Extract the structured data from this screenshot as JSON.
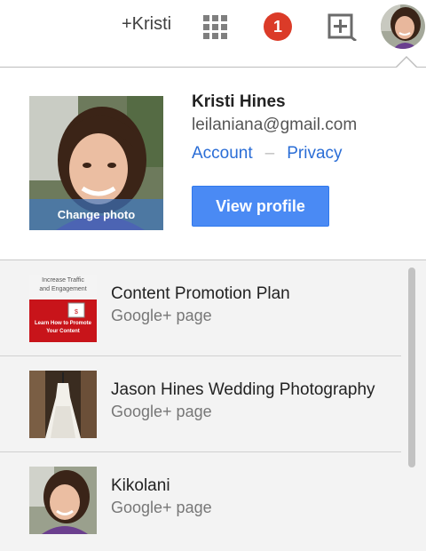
{
  "topbar": {
    "plus_name": "+Kristi",
    "notification_count": "1"
  },
  "user": {
    "name": "Kristi Hines",
    "email": "leilaniana@gmail.com",
    "account_link": "Account",
    "privacy_link": "Privacy",
    "separator": "–",
    "change_photo_label": "Change photo",
    "view_profile_label": "View profile"
  },
  "pages": [
    {
      "name": "Content Promotion Plan",
      "type": "Google+ page"
    },
    {
      "name": "Jason Hines Wedding Photography",
      "type": "Google+ page"
    },
    {
      "name": "Kikolani",
      "type": "Google+ page"
    }
  ],
  "promo_thumb": {
    "line1": "Increase Traffic",
    "line2": "and Engagement",
    "line3": "Learn How to Promote",
    "line4": "Your Content"
  },
  "colors": {
    "accent_blue": "#4a8af4",
    "link_blue": "#2a6dd6",
    "notification_red": "#db3b28"
  }
}
